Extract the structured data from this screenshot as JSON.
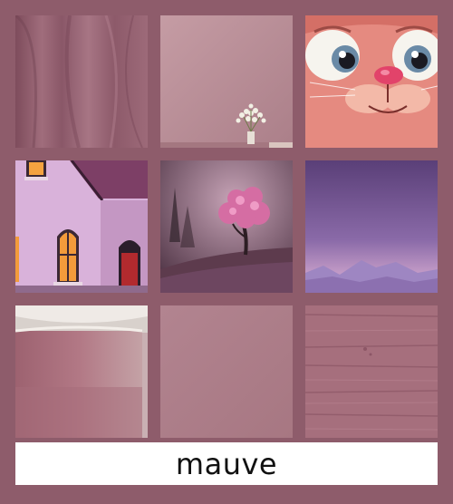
{
  "caption": {
    "label": "mauve"
  },
  "colors": {
    "background": "#8e5c6b",
    "caption_background": "#ffffff",
    "caption_text": "#111111"
  },
  "tiles": [
    {
      "subject": "draped-fabric"
    },
    {
      "subject": "wall-with-flower-vase"
    },
    {
      "subject": "cartoon-cat-face"
    },
    {
      "subject": "house-with-windows"
    },
    {
      "subject": "pink-tree-on-hill"
    },
    {
      "subject": "mountain-landscape"
    },
    {
      "subject": "bowl-rim"
    },
    {
      "subject": "plain-swatch"
    },
    {
      "subject": "wood-plank-texture"
    }
  ]
}
